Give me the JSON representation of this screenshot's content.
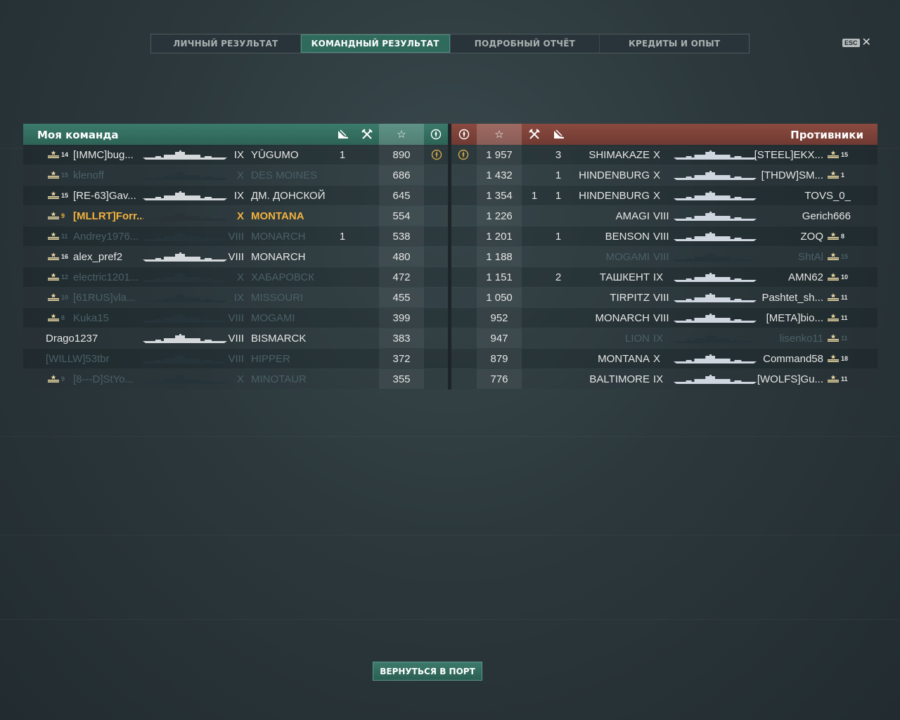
{
  "tabs": [
    {
      "label": "ЛИЧНЫЙ РЕЗУЛЬТАТ",
      "active": false
    },
    {
      "label": "КОМАНДНЫЙ РЕЗУЛЬТАТ",
      "active": true
    },
    {
      "label": "ПОДРОБНЫЙ ОТЧЁТ",
      "active": false
    },
    {
      "label": "КРЕДИТЫ И ОПЫТ",
      "active": false
    }
  ],
  "esc": {
    "key": "ESC",
    "close": "✕"
  },
  "left_team": {
    "title": "Моя команда",
    "column_icons": [
      "plane-kill-icon",
      "crossed-swords-icon",
      "star-icon",
      "rank-medal-icon"
    ],
    "rows": [
      {
        "rank": "14",
        "player": "[IMMC]bug...",
        "tier": "IX",
        "ship": "YŪGUMO",
        "planes": "",
        "kills": "1",
        "xp": "890",
        "medal": true,
        "status": "alive"
      },
      {
        "rank": "15",
        "player": "klenoff",
        "tier": "X",
        "ship": "DES MOINES",
        "planes": "",
        "kills": "",
        "xp": "686",
        "medal": false,
        "status": "dead"
      },
      {
        "rank": "15",
        "player": "[RE-63]Gav...",
        "tier": "IX",
        "ship": "ДМ. ДОНСКОЙ",
        "planes": "",
        "kills": "",
        "xp": "645",
        "medal": false,
        "status": "alive"
      },
      {
        "rank": "9",
        "player": "[MLLRT]Forr...",
        "tier": "X",
        "ship": "MONTANA",
        "planes": "",
        "kills": "",
        "xp": "554",
        "medal": false,
        "status": "self"
      },
      {
        "rank": "11",
        "player": "Andrey1976...",
        "tier": "VIII",
        "ship": "MONARCH",
        "planes": "",
        "kills": "1",
        "xp": "538",
        "medal": false,
        "status": "dead"
      },
      {
        "rank": "16",
        "player": "alex_pref2",
        "tier": "VIII",
        "ship": "MONARCH",
        "planes": "",
        "kills": "",
        "xp": "480",
        "medal": false,
        "status": "alive"
      },
      {
        "rank": "12",
        "player": "electric1201...",
        "tier": "X",
        "ship": "ХАБАРОВСК",
        "planes": "",
        "kills": "",
        "xp": "472",
        "medal": false,
        "status": "dead"
      },
      {
        "rank": "10",
        "player": "[61RUS]vla...",
        "tier": "IX",
        "ship": "MISSOURI",
        "planes": "",
        "kills": "",
        "xp": "455",
        "medal": false,
        "status": "dead"
      },
      {
        "rank": "8",
        "player": "Kuka15",
        "tier": "VIII",
        "ship": "MOGAMI",
        "planes": "",
        "kills": "",
        "xp": "399",
        "medal": false,
        "status": "dead"
      },
      {
        "rank": "",
        "player": "Drago1237",
        "tier": "VIII",
        "ship": "BISMARCK",
        "planes": "",
        "kills": "",
        "xp": "383",
        "medal": false,
        "status": "alive"
      },
      {
        "rank": "",
        "player": "[WILLW]53tbr",
        "tier": "VIII",
        "ship": "HIPPER",
        "planes": "",
        "kills": "",
        "xp": "372",
        "medal": false,
        "status": "dead"
      },
      {
        "rank": "9",
        "player": "[8---D]StYo...",
        "tier": "X",
        "ship": "MINOTAUR",
        "planes": "",
        "kills": "",
        "xp": "355",
        "medal": false,
        "status": "dead"
      }
    ]
  },
  "right_team": {
    "title": "Противники",
    "column_icons": [
      "rank-medal-icon",
      "star-icon",
      "crossed-swords-icon",
      "plane-kill-icon"
    ],
    "rows": [
      {
        "medal": true,
        "xp": "1 957",
        "kills": "3",
        "planes": "",
        "ship": "SHIMAKAZE",
        "tier": "X",
        "player": "[STEEL]EKX...",
        "rank": "15",
        "status": "alive"
      },
      {
        "medal": false,
        "xp": "1 432",
        "kills": "1",
        "planes": "",
        "ship": "HINDENBURG",
        "tier": "X",
        "player": "[THDW]SM...",
        "rank": "1",
        "status": "alive"
      },
      {
        "medal": false,
        "xp": "1 354",
        "kills": "1",
        "planes": "1",
        "ship": "HINDENBURG",
        "tier": "X",
        "player": "TOVS_0_",
        "rank": "",
        "status": "alive"
      },
      {
        "medal": false,
        "xp": "1 226",
        "kills": "",
        "planes": "",
        "ship": "AMAGI",
        "tier": "VIII",
        "player": "Gerich666",
        "rank": "",
        "status": "alive"
      },
      {
        "medal": false,
        "xp": "1 201",
        "kills": "1",
        "planes": "",
        "ship": "BENSON",
        "tier": "VIII",
        "player": "ZOQ",
        "rank": "8",
        "status": "alive"
      },
      {
        "medal": false,
        "xp": "1 188",
        "kills": "",
        "planes": "",
        "ship": "MOGAMI",
        "tier": "VIII",
        "player": "ShtAl",
        "rank": "15",
        "status": "dead"
      },
      {
        "medal": false,
        "xp": "1 151",
        "kills": "2",
        "planes": "",
        "ship": "ТАШКЕНТ",
        "tier": "IX",
        "player": "AMN62",
        "rank": "10",
        "status": "alive"
      },
      {
        "medal": false,
        "xp": "1 050",
        "kills": "",
        "planes": "",
        "ship": "TIRPITZ",
        "tier": "VIII",
        "player": "Pashtet_sh...",
        "rank": "11",
        "status": "alive"
      },
      {
        "medal": false,
        "xp": "952",
        "kills": "",
        "planes": "",
        "ship": "MONARCH",
        "tier": "VIII",
        "player": "[META]bio...",
        "rank": "11",
        "status": "alive"
      },
      {
        "medal": false,
        "xp": "947",
        "kills": "",
        "planes": "",
        "ship": "LION",
        "tier": "IX",
        "player": "lisenko11",
        "rank": "11",
        "status": "dead"
      },
      {
        "medal": false,
        "xp": "879",
        "kills": "",
        "planes": "",
        "ship": "MONTANA",
        "tier": "X",
        "player": "Command58",
        "rank": "18",
        "status": "alive"
      },
      {
        "medal": false,
        "xp": "776",
        "kills": "",
        "planes": "",
        "ship": "BALTIMORE",
        "tier": "IX",
        "player": "[WOLFS]Gu...",
        "rank": "11",
        "status": "alive"
      }
    ]
  },
  "return_button": "ВЕРНУТЬСЯ В ПОРТ",
  "colors": {
    "ally_header": "#2f6a5c",
    "enemy_header": "#7a4036",
    "self_highlight": "#f2b23d",
    "dead_text": "#4a6066",
    "alive_text": "#e6e6e6"
  }
}
